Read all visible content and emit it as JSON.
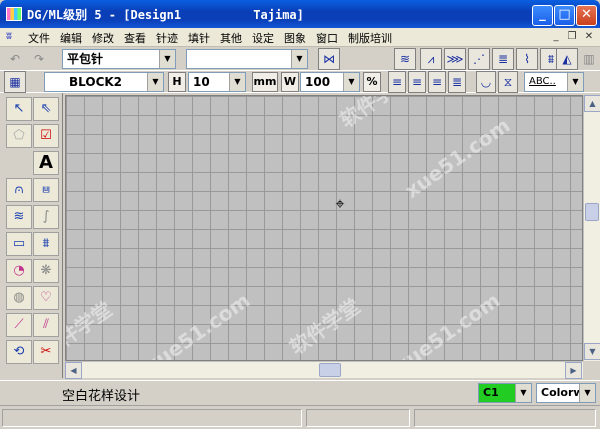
{
  "window": {
    "title": "DG/ML级别 5 - [Design1          Tajima]",
    "minimize": "_",
    "maximize": "□",
    "close": "✕"
  },
  "menu": {
    "items": [
      "文件",
      "编辑",
      "修改",
      "查看",
      "针迹",
      "填针",
      "其他",
      "设定",
      "图象",
      "窗口",
      "制版培训"
    ],
    "mdi_min": "_",
    "mdi_restore": "❐",
    "mdi_close": "✕"
  },
  "toolbar1": {
    "stitch_type": "平包针",
    "pattern_select": ""
  },
  "toolbar2": {
    "font": "BLOCK2",
    "height_label": "H",
    "height_value": "10",
    "unit": "mm",
    "width_label": "W",
    "width_value": "100",
    "percent": "%",
    "abc_sample": "ABC.."
  },
  "palette": {
    "text_tool": "A"
  },
  "status": {
    "message": "空白花样设计",
    "color_code": "C1",
    "color_mode": "Colorw"
  },
  "colors": {
    "color_swatch": "#22cc22",
    "canvas_bg": "#c0c0c0",
    "grid_line": "#999999"
  },
  "watermarks": [
    "软件学堂",
    "xue51.com"
  ]
}
